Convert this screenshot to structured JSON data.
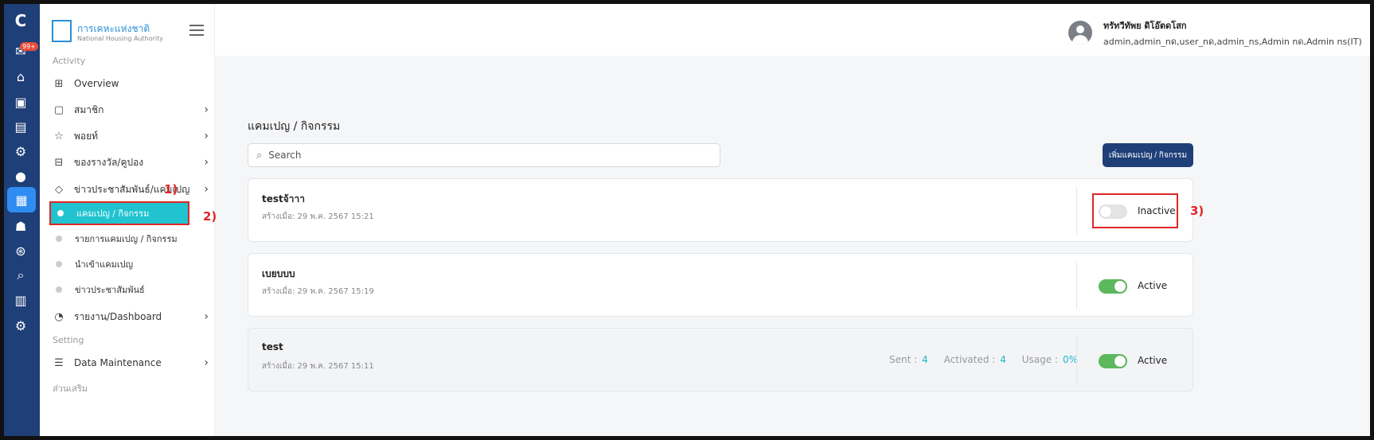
{
  "rail": {
    "badge": "99+",
    "icons": [
      "brand-logo-icon",
      "mail-icon",
      "home-icon",
      "cards-icon",
      "document-icon",
      "gear-shield-icon",
      "user-icon",
      "dashboard-icon",
      "group-icon",
      "settings-circle-icon",
      "search-icon",
      "bar-chart-icon",
      "gears-icon"
    ]
  },
  "sidebar": {
    "logo_th": "การเคหะแห่งชาติ",
    "logo_en": "National Housing Authority",
    "section_activity": "Activity",
    "items": [
      {
        "label": "Overview"
      },
      {
        "label": "สมาชิก"
      },
      {
        "label": "พอยท์"
      },
      {
        "label": "ของรางวัล/คูปอง"
      },
      {
        "label": "ข่าวประชาสัมพันธ์/แคมเปญ"
      }
    ],
    "subitems": [
      {
        "label": "แคมเปญ / กิจกรรม"
      },
      {
        "label": "รายการแคมเปญ / กิจกรรม"
      },
      {
        "label": "นำเข้าแคมเปญ"
      },
      {
        "label": "ข่าวประชาสัมพันธ์"
      }
    ],
    "report": "รายงาน/Dashboard",
    "section_setting": "Setting",
    "data_maintenance": "Data Maintenance",
    "section_extra": "ส่วนเสริม"
  },
  "annotations": {
    "a1": "1)",
    "a2": "2)",
    "a3": "3)"
  },
  "header": {
    "user_name": "ทรัทวีทัพย ดิโอ๊ตดโสก",
    "user_roles": "admin,admin_nด,user_nด,admin_ns,Admin nด,Admin ns(IT)"
  },
  "main": {
    "title": "แคมเปญ / กิจกรรม",
    "search_placeholder": "Search",
    "add_button": "เพิ่มแคมเปญ / กิจกรรม",
    "cards": [
      {
        "name": "testจ้าาา",
        "created": "สร้างเมื่อ: 29 พ.ค. 2567 15:21",
        "status": "Inactive"
      },
      {
        "name": "เบยบบบ",
        "created": "สร้างเมื่อ: 29 พ.ค. 2567 15:19",
        "status": "Active"
      },
      {
        "name": "test",
        "created": "สร้างเมื่อ: 29 พ.ค. 2567 15:11",
        "status": "Active",
        "sent_label": "Sent :",
        "sent": "4",
        "activated_label": "Activated :",
        "activated": "4",
        "usage_label": "Usage :",
        "usage": "0%"
      }
    ]
  }
}
